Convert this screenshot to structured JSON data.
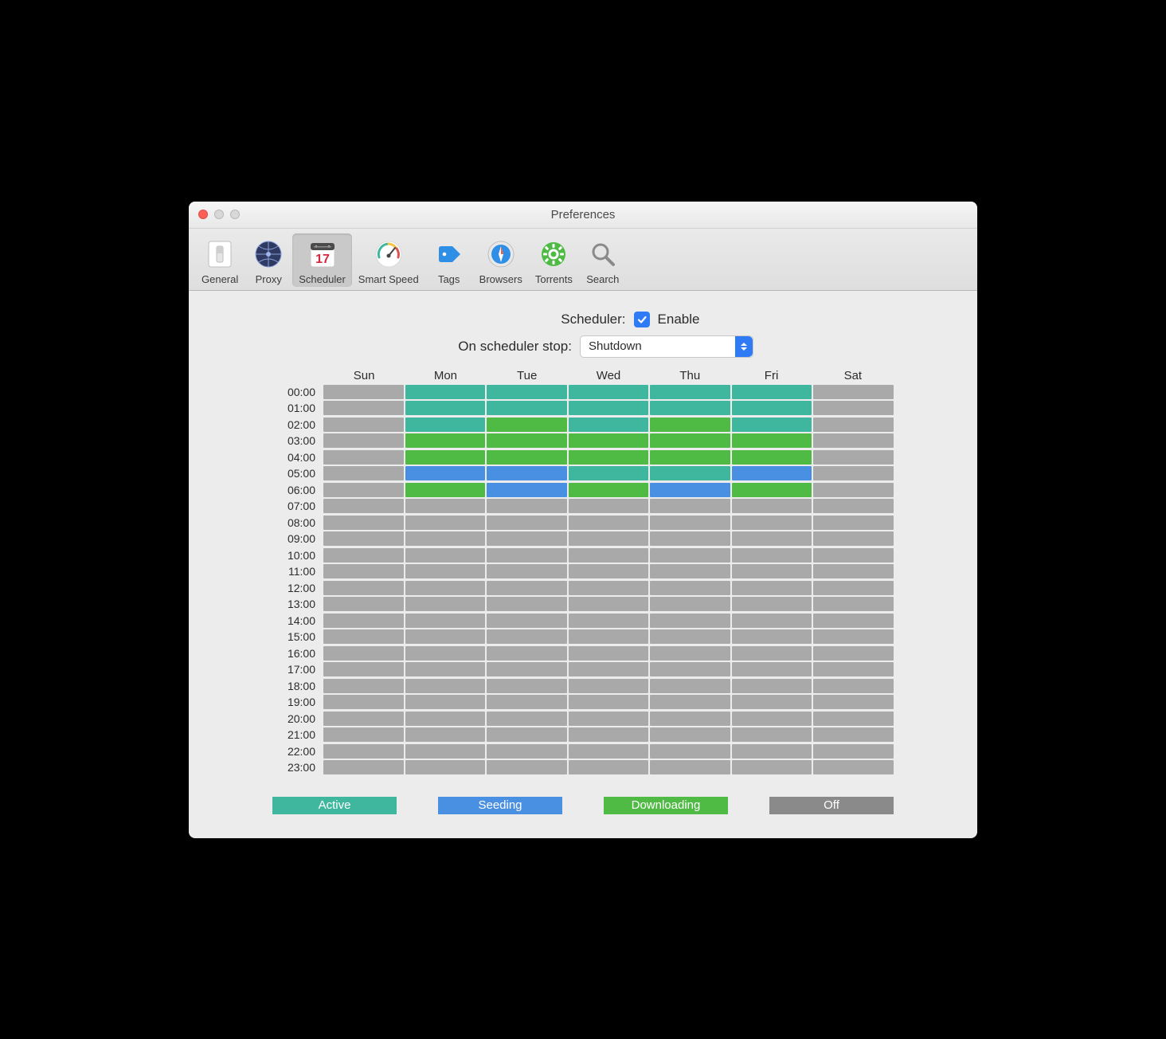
{
  "window": {
    "title": "Preferences"
  },
  "toolbar": {
    "items": [
      {
        "label": "General"
      },
      {
        "label": "Proxy"
      },
      {
        "label": "Scheduler"
      },
      {
        "label": "Smart Speed"
      },
      {
        "label": "Tags"
      },
      {
        "label": "Browsers"
      },
      {
        "label": "Torrents"
      },
      {
        "label": "Search"
      }
    ],
    "selected_index": 2
  },
  "form": {
    "scheduler_label": "Scheduler:",
    "enable_label": "Enable",
    "enable_checked": true,
    "on_stop_label": "On scheduler stop:",
    "on_stop_value": "Shutdown"
  },
  "days": [
    "Sun",
    "Mon",
    "Tue",
    "Wed",
    "Thu",
    "Fri",
    "Sat"
  ],
  "hours": [
    "00:00",
    "01:00",
    "02:00",
    "03:00",
    "04:00",
    "05:00",
    "06:00",
    "07:00",
    "08:00",
    "09:00",
    "10:00",
    "11:00",
    "12:00",
    "13:00",
    "14:00",
    "15:00",
    "16:00",
    "17:00",
    "18:00",
    "19:00",
    "20:00",
    "21:00",
    "22:00",
    "23:00"
  ],
  "schedule": [
    [
      "off",
      "active",
      "active",
      "active",
      "active",
      "active",
      "off"
    ],
    [
      "off",
      "active",
      "active",
      "active",
      "active",
      "active",
      "off"
    ],
    [
      "off",
      "active",
      "down",
      "active",
      "down",
      "active",
      "off"
    ],
    [
      "off",
      "down",
      "down",
      "down",
      "down",
      "down",
      "off"
    ],
    [
      "off",
      "down",
      "down",
      "down",
      "down",
      "down",
      "off"
    ],
    [
      "off",
      "seed",
      "seed",
      "active",
      "active",
      "seed",
      "off"
    ],
    [
      "off",
      "down",
      "seed",
      "down",
      "seed",
      "down",
      "off"
    ],
    [
      "off",
      "off",
      "off",
      "off",
      "off",
      "off",
      "off"
    ],
    [
      "off",
      "off",
      "off",
      "off",
      "off",
      "off",
      "off"
    ],
    [
      "off",
      "off",
      "off",
      "off",
      "off",
      "off",
      "off"
    ],
    [
      "off",
      "off",
      "off",
      "off",
      "off",
      "off",
      "off"
    ],
    [
      "off",
      "off",
      "off",
      "off",
      "off",
      "off",
      "off"
    ],
    [
      "off",
      "off",
      "off",
      "off",
      "off",
      "off",
      "off"
    ],
    [
      "off",
      "off",
      "off",
      "off",
      "off",
      "off",
      "off"
    ],
    [
      "off",
      "off",
      "off",
      "off",
      "off",
      "off",
      "off"
    ],
    [
      "off",
      "off",
      "off",
      "off",
      "off",
      "off",
      "off"
    ],
    [
      "off",
      "off",
      "off",
      "off",
      "off",
      "off",
      "off"
    ],
    [
      "off",
      "off",
      "off",
      "off",
      "off",
      "off",
      "off"
    ],
    [
      "off",
      "off",
      "off",
      "off",
      "off",
      "off",
      "off"
    ],
    [
      "off",
      "off",
      "off",
      "off",
      "off",
      "off",
      "off"
    ],
    [
      "off",
      "off",
      "off",
      "off",
      "off",
      "off",
      "off"
    ],
    [
      "off",
      "off",
      "off",
      "off",
      "off",
      "off",
      "off"
    ],
    [
      "off",
      "off",
      "off",
      "off",
      "off",
      "off",
      "off"
    ],
    [
      "off",
      "off",
      "off",
      "off",
      "off",
      "off",
      "off"
    ]
  ],
  "legend": {
    "active": "Active",
    "seeding": "Seeding",
    "downloading": "Downloading",
    "off": "Off"
  },
  "colors": {
    "active": "#3fb79e",
    "seeding": "#4a90e2",
    "downloading": "#4fbb44",
    "off_cell": "#a9a9a9",
    "off_legend": "#8a8a8a"
  }
}
